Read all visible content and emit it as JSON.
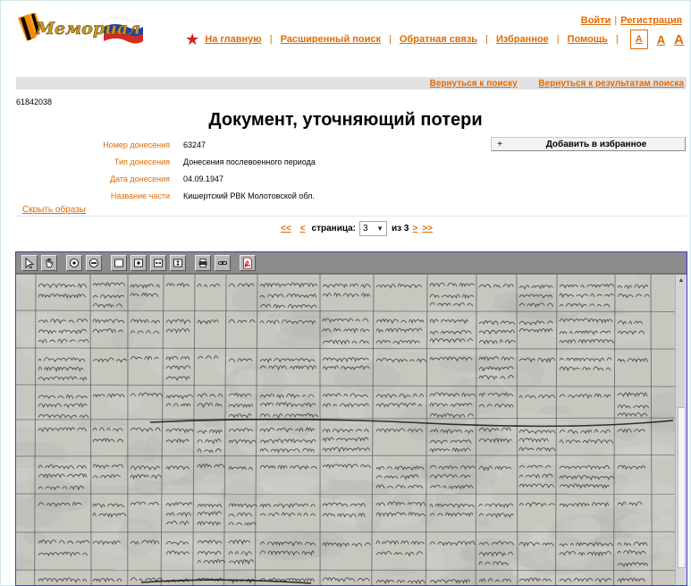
{
  "header": {
    "logo_text": "Мемориал",
    "login": "Войти",
    "register": "Регистрация"
  },
  "nav": {
    "items": [
      "На главную",
      "Расширенный поиск",
      "Обратная связь",
      "Избранное",
      "Помощь"
    ],
    "font_sizes": [
      "A",
      "A",
      "A"
    ],
    "star_color": "#d0202a"
  },
  "back_links": {
    "to_search": "Вернуться к поиску",
    "to_results": "Вернуться к результатам поиска"
  },
  "document": {
    "id": "61842038",
    "title": "Документ, уточняющий потери",
    "fields": [
      {
        "label": "Номер донесения",
        "value": "63247"
      },
      {
        "label": "Тип донесения",
        "value": "Донесения послевоенного периода"
      },
      {
        "label": "Дата донесения",
        "value": "04.09.1947"
      },
      {
        "label": "Название части",
        "value": "Кишертский РВК Молотовской обл."
      }
    ],
    "add_favorite": "Добавить в избранное",
    "add_favorite_icon": "+"
  },
  "images": {
    "hide_label": "Скрыть образы"
  },
  "pager": {
    "first": "<<",
    "prev": "<",
    "page_label": "страница:",
    "current": "3",
    "of_label": "из 3",
    "next": ">",
    "last": ">>"
  },
  "colors": {
    "accent": "#e46a00",
    "viewer_border": "#3b3bd0"
  }
}
